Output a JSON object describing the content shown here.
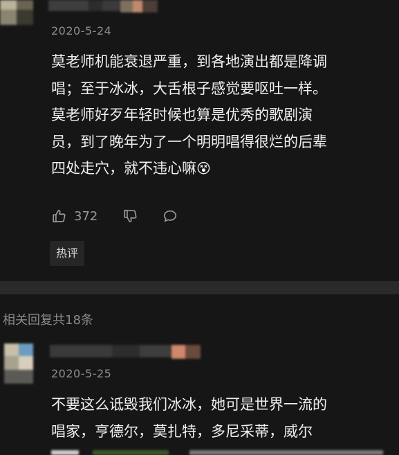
{
  "comment1": {
    "date": "2020-5-24",
    "lines": [
      "莫老师机能衰退严重，到各地演出都是降调",
      "唱；至于冰冰，大舌根子感觉要呕吐一样。",
      "莫老师好歹年轻时候也算是优秀的歌剧演",
      "员，到了晚年为了一个明明唱得很烂的后辈",
      "四处走穴，就不违心嘛"
    ],
    "emoji": "😵",
    "likes": "372",
    "hot_tag": "热评"
  },
  "replies": {
    "label": "相关回复共18条"
  },
  "comment2": {
    "date": "2020-5-25",
    "lines": [
      "不要这么诋毁我们冰冰，她可是世界一流的",
      "唱家，亨德尔，莫扎特，多尼采蒂，威尔"
    ]
  }
}
